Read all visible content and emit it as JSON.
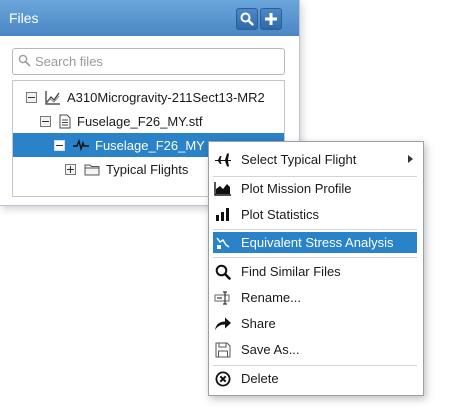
{
  "panel": {
    "title": "Files",
    "search_placeholder": "Search files"
  },
  "tree": {
    "items": [
      {
        "label": "A310Microgravity-211Sect13-MR2",
        "icon": "chart-icon",
        "expander": "collapse"
      },
      {
        "label": "Fuselage_F26_MY.stf",
        "icon": "document-icon",
        "expander": "collapse"
      },
      {
        "label": "Fuselage_F26_MY",
        "icon": "waveform-icon",
        "expander": "collapse",
        "selected": true
      },
      {
        "label": "Typical Flights",
        "icon": "folder-icon",
        "expander": "expand"
      }
    ]
  },
  "menu": {
    "items": [
      {
        "label": "Select Typical Flight",
        "icon": "airplane-icon",
        "submenu": true
      },
      {
        "label": "Plot Mission Profile",
        "icon": "area-chart-icon"
      },
      {
        "label": "Plot Statistics",
        "icon": "bar-chart-icon"
      },
      {
        "label": "Equivalent Stress Analysis",
        "icon": "stress-analysis-icon",
        "highlighted": true
      },
      {
        "label": "Find Similar Files",
        "icon": "magnifier-icon"
      },
      {
        "label": "Rename...",
        "icon": "rename-icon"
      },
      {
        "label": "Share",
        "icon": "share-arrow-icon"
      },
      {
        "label": "Save As...",
        "icon": "floppy-icon"
      },
      {
        "label": "Delete",
        "icon": "delete-circle-icon"
      }
    ]
  },
  "colors": {
    "header": "#4a86c3",
    "selection": "#2a82c8"
  }
}
